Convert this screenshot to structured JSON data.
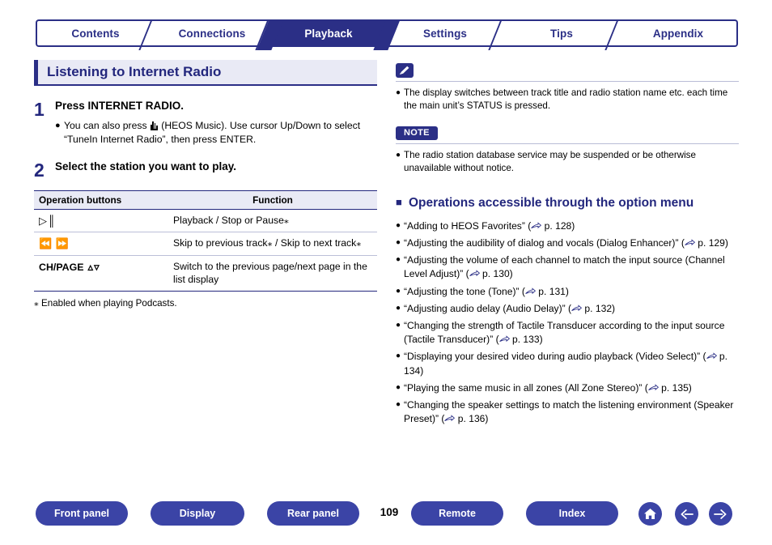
{
  "tabs": [
    {
      "label": "Contents",
      "active": false
    },
    {
      "label": "Connections",
      "active": false
    },
    {
      "label": "Playback",
      "active": true
    },
    {
      "label": "Settings",
      "active": false
    },
    {
      "label": "Tips",
      "active": false
    },
    {
      "label": "Appendix",
      "active": false
    }
  ],
  "left": {
    "heading": "Listening to Internet Radio",
    "steps": [
      {
        "num": "1",
        "title": "Press INTERNET RADIO.",
        "bullet_pre": "You can also press ",
        "bullet_post": " (HEOS Music). Use cursor Up/Down to select “TuneIn Internet Radio”, then press ENTER."
      },
      {
        "num": "2",
        "title": "Select the station you want to play."
      }
    ],
    "table": {
      "headers": [
        "Operation buttons",
        "Function"
      ],
      "rows": [
        {
          "buttons": "⏯",
          "buttons_kind": "playpause",
          "function": "Playback / Stop or Pause⁎"
        },
        {
          "buttons": "⏮ ⏭",
          "buttons_kind": "skip",
          "function": "Skip to previous track⁎ / Skip to next track⁎"
        },
        {
          "buttons": "CH/PAGE ∧∨",
          "buttons_kind": "chpage",
          "function": "Switch to the previous page/next page in the list display"
        }
      ]
    },
    "footnote": "⁎ Enabled when playing Podcasts."
  },
  "right": {
    "pencil_note": "The display switches between track title and radio station name etc. each time the main unit’s STATUS is pressed.",
    "note_tag": "NOTE",
    "note_text": "The radio station database service may be suspended or be otherwise unavailable without notice.",
    "section_heading": "Operations accessible through the option menu",
    "links": [
      {
        "text": "“Adding to HEOS Favorites” (",
        "page": "p. 128"
      },
      {
        "text": "“Adjusting the audibility of dialog and vocals (Dialog Enhancer)” (",
        "page": "p. 129"
      },
      {
        "text": "“Adjusting the volume of each channel to match the input source (Channel Level Adjust)” (",
        "page": "p. 130"
      },
      {
        "text": "“Adjusting the tone (Tone)” (",
        "page": "p. 131"
      },
      {
        "text": "“Adjusting audio delay (Audio Delay)” (",
        "page": "p. 132"
      },
      {
        "text": "“Changing the strength of Tactile Transducer according to the input source (Tactile Transducer)” (",
        "page": "p. 133"
      },
      {
        "text": "“Displaying your desired video during audio playback (Video Select)” (",
        "page": "p. 134"
      },
      {
        "text": "“Playing the same music in all zones (All Zone Stereo)” (",
        "page": "p. 135"
      },
      {
        "text": "“Changing the speaker settings to match the listening environment (Speaker Preset)” (",
        "page": "p. 136"
      }
    ]
  },
  "footer": {
    "buttons": [
      {
        "label": "Front panel"
      },
      {
        "label": "Display"
      },
      {
        "label": "Rear panel"
      },
      {
        "label": "Remote"
      },
      {
        "label": "Index"
      }
    ],
    "page_number": "109",
    "icons": [
      "home-icon",
      "back-arrow-icon",
      "forward-arrow-icon"
    ]
  },
  "colors": {
    "brand": "#2b2f86",
    "button": "#3b44a6",
    "heading_bg": "#e9eaf5"
  }
}
